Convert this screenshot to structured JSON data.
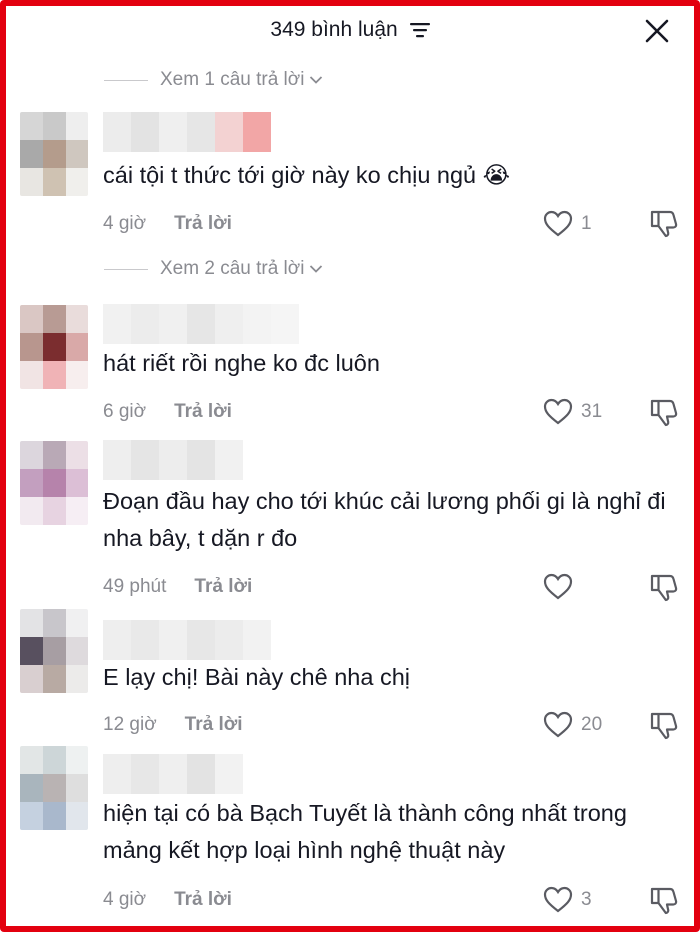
{
  "header": {
    "title": "349 bình luận"
  },
  "comments": [
    {
      "replies_label": "Xem 1 câu trả lời"
    },
    {
      "text": "cái tội t thức tới giờ này ko chịu ngủ 😭",
      "time": "4 giờ",
      "reply": "Trả lời",
      "likes": "1",
      "replies_label": "Xem 2 câu trả lời",
      "avatar": [
        "#d6d6d6",
        "#c9c9c9",
        "#eeeeee",
        "#a9a9a9",
        "#b49c8c",
        "#cfc7bf",
        "#e8e6e2",
        "#cfc2b2",
        "#f0efec"
      ],
      "name": [
        "#ececec",
        "#e3e3e3",
        "#efefef",
        "#e6e6e6",
        "#f3d2d2",
        "#f2a6a6"
      ]
    },
    {
      "text": "hát riết rồi nghe ko đc luôn",
      "time": "6 giờ",
      "reply": "Trả lời",
      "likes": "31",
      "avatar": [
        "#dac7c4",
        "#b89b94",
        "#e9dcdb",
        "#b8968e",
        "#7b2d2f",
        "#d9a9a8",
        "#f1e4e4",
        "#f0b3b6",
        "#f7eeee"
      ],
      "name": [
        "#f1f1f1",
        "#ececec",
        "#f0f0f0",
        "#e6e6e6",
        "#efefef",
        "#f3f3f3",
        "#f5f5f5"
      ]
    },
    {
      "text": "Đoạn đầu hay cho tới khúc cải lương phối gi là nghỉ đi nha bây, t dặn r đo",
      "time": "49 phút",
      "reply": "Trả lời",
      "likes": "",
      "avatar": [
        "#dcd6dd",
        "#b9a9b6",
        "#ecdfe6",
        "#c39fbf",
        "#b683ab",
        "#dcbfd6",
        "#f2eaf0",
        "#e7d3e1",
        "#f6eef4"
      ],
      "name": [
        "#eeeeee",
        "#e5e5e5",
        "#ededed",
        "#e4e4e4",
        "#f1f1f1"
      ]
    },
    {
      "text": "E lạy chị! Bài này chê nha chị",
      "time": "12 giờ",
      "reply": "Trả lời",
      "likes": "20",
      "avatar": [
        "#e3e3e5",
        "#c8c6cb",
        "#f0f0f1",
        "#58505f",
        "#a79ea3",
        "#dedadd",
        "#d9cfd0",
        "#b8aaa3",
        "#ecebea"
      ],
      "name": [
        "#eeeeee",
        "#e9e9e9",
        "#f0f0f0",
        "#e7e7e7",
        "#ececec",
        "#f2f2f2"
      ]
    },
    {
      "text": "hiện tại có bà Bạch Tuyết là thành công nhất trong mảng kết hợp loại hình nghệ thuật này",
      "time": "4 giờ",
      "reply": "Trả lời",
      "likes": "3",
      "avatar": [
        "#e2e6e6",
        "#cdd6d8",
        "#eef1f1",
        "#a9b5bd",
        "#b9b3b3",
        "#dedede",
        "#c5d1e0",
        "#a9b8cc",
        "#e1e6ec"
      ],
      "name": [
        "#eeeeee",
        "#e7e7e7",
        "#efefef",
        "#e3e3e3",
        "#f2f2f2"
      ]
    }
  ]
}
